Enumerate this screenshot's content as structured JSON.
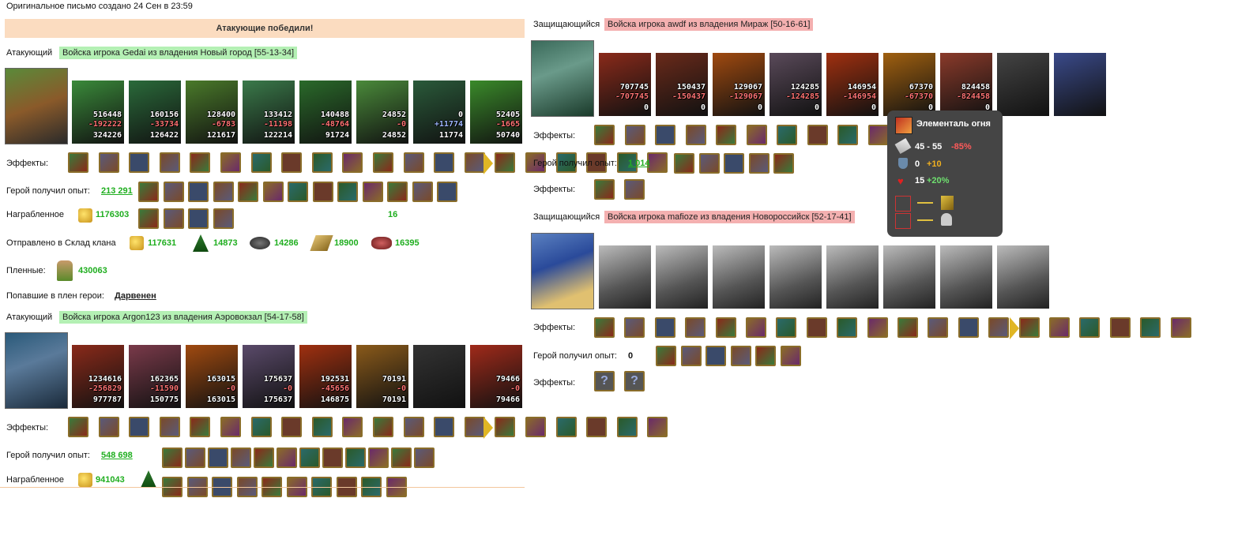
{
  "header": {
    "created": "Оригинальное письмо создано 24 Сен в 23:59"
  },
  "banner": "Атакующие победили!",
  "labels": {
    "attacker": "Атакующий",
    "defender": "Защищающийся",
    "effects": "Эффекты:",
    "exp": "Герой получил опыт:",
    "loot": "Награбленное",
    "clan": "Отправлено в Склад клана",
    "captives": "Пленные:",
    "captured_heroes": "Попавшие в плен герои:"
  },
  "a1": {
    "tag": "Войска игрока Gedai из владения Новый город [55-13-34]",
    "exp": "213 291",
    "loot": "1176303",
    "loot2": "16",
    "clan": [
      "117631",
      "14873",
      "14286",
      "18900",
      "16395"
    ],
    "captives": "430063",
    "captured_hero": "Дарвенен",
    "units": [
      [
        "516448",
        "-192222",
        "324226"
      ],
      [
        "160156",
        "-33734",
        "126422"
      ],
      [
        "128400",
        "-6783",
        "121617"
      ],
      [
        "133412",
        "-11198",
        "122214"
      ],
      [
        "140488",
        "-48764",
        "91724"
      ],
      [
        "24852",
        "-0",
        "24852"
      ],
      [
        "0",
        "+11774",
        "11774"
      ],
      [
        "52405",
        "-1665",
        "50740"
      ]
    ]
  },
  "a2": {
    "tag": "Войска игрока Argon123 из владения Аэровокзал [54-17-58]",
    "exp": "548 698",
    "loot": "941043",
    "units": [
      [
        "1234616",
        "-256829",
        "977787"
      ],
      [
        "162365",
        "-11590",
        "150775"
      ],
      [
        "163015",
        "-0",
        "163015"
      ],
      [
        "175637",
        "-0",
        "175637"
      ],
      [
        "192531",
        "-45656",
        "146875"
      ],
      [
        "70191",
        "-0",
        "70191"
      ],
      [
        "",
        "",
        ""
      ],
      [
        "79466",
        "-0",
        "79466"
      ]
    ]
  },
  "d1": {
    "tag": "Войска игрока awdf из владения Мираж [50-16-61]",
    "exp": "1 014",
    "units": [
      [
        "707745",
        "-707745",
        "0"
      ],
      [
        "150437",
        "-150437",
        "0"
      ],
      [
        "129067",
        "-129067",
        "0"
      ],
      [
        "124285",
        "-124285",
        "0"
      ],
      [
        "146954",
        "-146954",
        "0"
      ],
      [
        "67370",
        "-67370",
        "0"
      ],
      [
        "824458",
        "-824458",
        "0"
      ]
    ]
  },
  "d2": {
    "tag": "Войска игрока mafioze из владения Новороссийск [52-17-41]",
    "exp": "0"
  },
  "tooltip": {
    "title": "Элементаль огня",
    "atk": "45 - 55",
    "atk_mod": "-85%",
    "def": "0",
    "def_mod": "+10",
    "hp": "15",
    "hp_mod": "+20%"
  },
  "colors": {
    "green": "#1fae1f",
    "attacker_bg": "#b4f0b4",
    "defender_bg": "#f4b0b0",
    "banner_bg": "#fbdcc0"
  }
}
